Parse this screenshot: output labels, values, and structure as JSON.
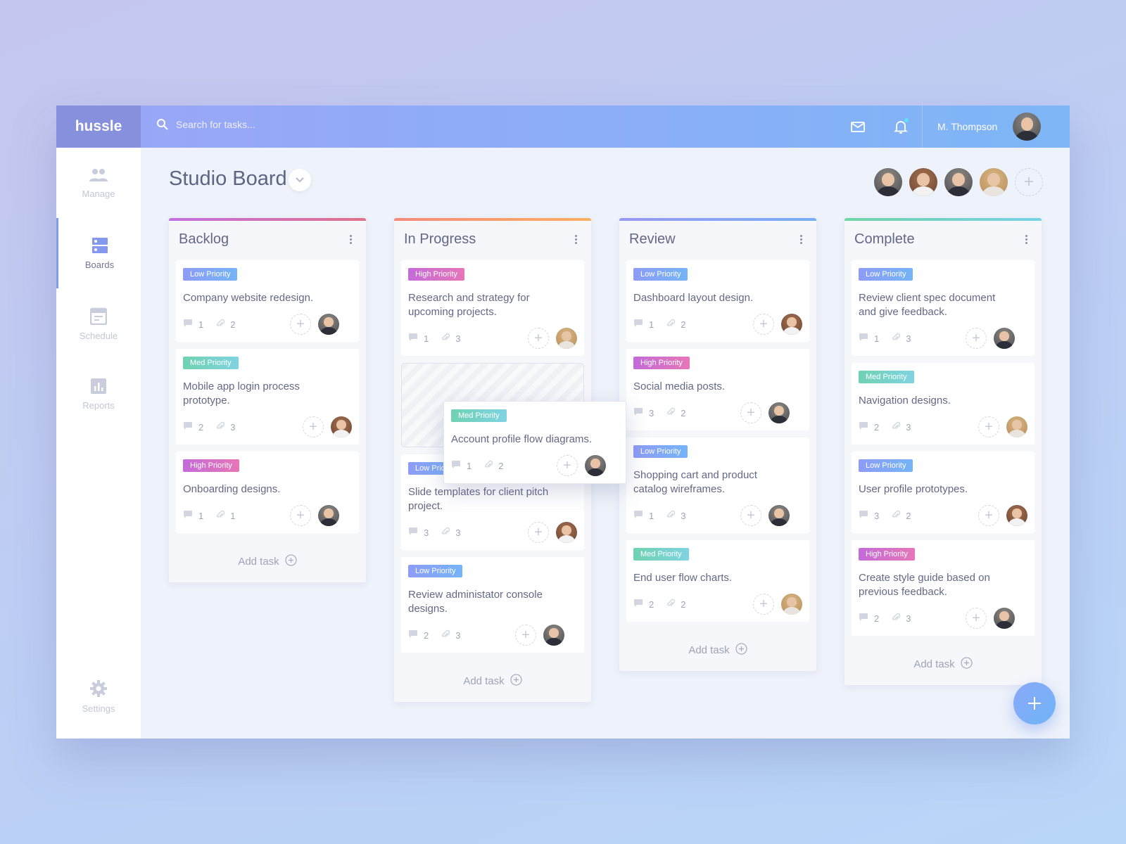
{
  "app": {
    "logo": "hussle"
  },
  "header": {
    "search_placeholder": "Search for tasks...",
    "user_name": "M. Thompson",
    "icons": [
      "search-icon",
      "mail-icon",
      "bell-icon"
    ],
    "notification_dot": true
  },
  "sidebar": {
    "items": [
      {
        "label": "Manage",
        "icon": "people-icon"
      },
      {
        "label": "Boards",
        "icon": "boards-icon",
        "active": true
      },
      {
        "label": "Schedule",
        "icon": "calendar-icon"
      },
      {
        "label": "Reports",
        "icon": "chart-icon"
      }
    ],
    "settings": {
      "label": "Settings",
      "icon": "gear-icon"
    }
  },
  "board": {
    "title": "Studio Board",
    "members": [
      "m",
      "f",
      "m",
      "b"
    ],
    "add_task_label": "Add task"
  },
  "colors": {
    "low": "#8d9cf7",
    "med": "#6fd2b2",
    "high": "#c46bd8",
    "accent": "#7d9cf6"
  },
  "columns": [
    {
      "title": "Backlog",
      "bar": "linear-gradient(90deg,#c36fe0,#e0708a)",
      "cards": [
        {
          "priority": "low",
          "tag": "Low Priority",
          "text": "Company website redesign.",
          "comments": "1",
          "attachments": "2",
          "avatar": "m"
        },
        {
          "priority": "med",
          "tag": "Med Priority",
          "text": "Mobile app login process prototype.",
          "comments": "2",
          "attachments": "3",
          "avatar": "f"
        },
        {
          "priority": "high",
          "tag": "High Priority",
          "text": "Onboarding designs.",
          "comments": "1",
          "attachments": "1",
          "avatar": "m"
        }
      ]
    },
    {
      "title": "In Progress",
      "bar": "linear-gradient(90deg,#f78a7c,#fbb05f)",
      "placeholder_after": 1,
      "cards": [
        {
          "priority": "high",
          "tag": "High Priority",
          "text": "Research and strategy for upcoming projects.",
          "comments": "1",
          "attachments": "3",
          "avatar": "b"
        },
        {
          "priority": "low",
          "tag": "Low Priority",
          "text": "Slide templates for client pitch project.",
          "comments": "3",
          "attachments": "3",
          "avatar": "f"
        },
        {
          "priority": "low",
          "tag": "Low Priority",
          "text": "Review administator console designs.",
          "comments": "2",
          "attachments": "3",
          "avatar": "m"
        }
      ]
    },
    {
      "title": "Review",
      "bar": "linear-gradient(90deg,#9a98f4,#78aef6)",
      "cards": [
        {
          "priority": "low",
          "tag": "Low Priority",
          "text": "Dashboard layout design.",
          "comments": "1",
          "attachments": "2",
          "avatar": "f"
        },
        {
          "priority": "high",
          "tag": "High Priority",
          "text": "Social media posts.",
          "comments": "3",
          "attachments": "2",
          "avatar": "m"
        },
        {
          "priority": "low",
          "tag": "Low Priority",
          "text": "Shopping cart and product catalog wireframes.",
          "comments": "1",
          "attachments": "3",
          "avatar": "m"
        },
        {
          "priority": "med",
          "tag": "Med Priority",
          "text": "End user flow charts.",
          "comments": "2",
          "attachments": "2",
          "avatar": "b"
        }
      ]
    },
    {
      "title": "Complete",
      "bar": "linear-gradient(90deg,#6fd6a8,#76d2e6)",
      "cards": [
        {
          "priority": "low",
          "tag": "Low Priority",
          "text": "Review client spec document and give feedback.",
          "comments": "1",
          "attachments": "3",
          "avatar": "m"
        },
        {
          "priority": "med",
          "tag": "Med Priority",
          "text": "Navigation designs.",
          "comments": "2",
          "attachments": "3",
          "avatar": "b"
        },
        {
          "priority": "low",
          "tag": "Low Priority",
          "text": "User profile prototypes.",
          "comments": "3",
          "attachments": "2",
          "avatar": "f"
        },
        {
          "priority": "high",
          "tag": "High Priority",
          "text": "Create style guide based on previous feedback.",
          "comments": "2",
          "attachments": "3",
          "avatar": "m"
        }
      ]
    }
  ],
  "dragging_card": {
    "priority": "med",
    "tag": "Med Priority",
    "text": "Account profile flow diagrams.",
    "comments": "1",
    "attachments": "2",
    "avatar": "m"
  }
}
